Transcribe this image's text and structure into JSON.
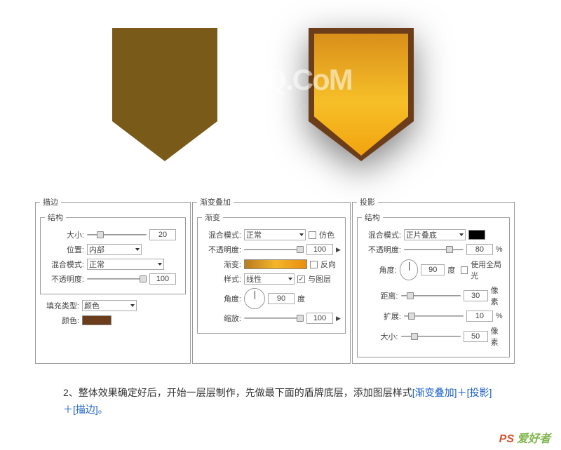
{
  "watermark": "UiBQ.CoM",
  "corner": {
    "ps": "PS",
    "txt": "爱好者"
  },
  "caption": {
    "num": "2、",
    "body": "整体效果确定好后，开始一层层制作，先做最下面的盾牌底层，添加图层样式",
    "links": "[渐变叠加]＋[投影]＋[描边]。"
  },
  "stroke": {
    "legend_outer": "描边",
    "legend_inner": "结构",
    "size_lbl": "大小:",
    "size_val": "20",
    "pos_lbl": "位置:",
    "pos_val": "内部",
    "blend_lbl": "混合模式:",
    "blend_val": "正常",
    "opa_lbl": "不透明度:",
    "opa_val": "100",
    "fill_lbl": "填充类型:",
    "fill_val": "颜色",
    "color_lbl": "颜色:",
    "color": "#6b3d1a"
  },
  "gradient": {
    "legend_outer": "渐变叠加",
    "legend_inner": "渐变",
    "blend_lbl": "混合模式:",
    "blend_val": "正常",
    "dither_lbl": "仿色",
    "opa_lbl": "不透明度:",
    "opa_val": "100",
    "grad_lbl": "渐变:",
    "rev_lbl": "反向",
    "style_lbl": "样式:",
    "style_val": "线性",
    "align_lbl": "与图层",
    "angle_lbl": "角度:",
    "angle_val": "90",
    "deg": "度",
    "scale_lbl": "缩放:",
    "scale_val": "100"
  },
  "shadow": {
    "legend_outer": "投影",
    "legend_inner": "结构",
    "blend_lbl": "混合模式:",
    "blend_val": "正片叠底",
    "opa_lbl": "不透明度:",
    "opa_val": "80",
    "pct": "%",
    "angle_lbl": "角度:",
    "angle_val": "90",
    "deg": "度",
    "global_lbl": "使用全局光",
    "dist_lbl": "距离:",
    "dist_val": "30",
    "px": "像素",
    "spread_lbl": "扩展:",
    "spread_val": "10",
    "pct2": "%",
    "size_lbl": "大小:",
    "size_val": "50",
    "px2": "像素"
  }
}
